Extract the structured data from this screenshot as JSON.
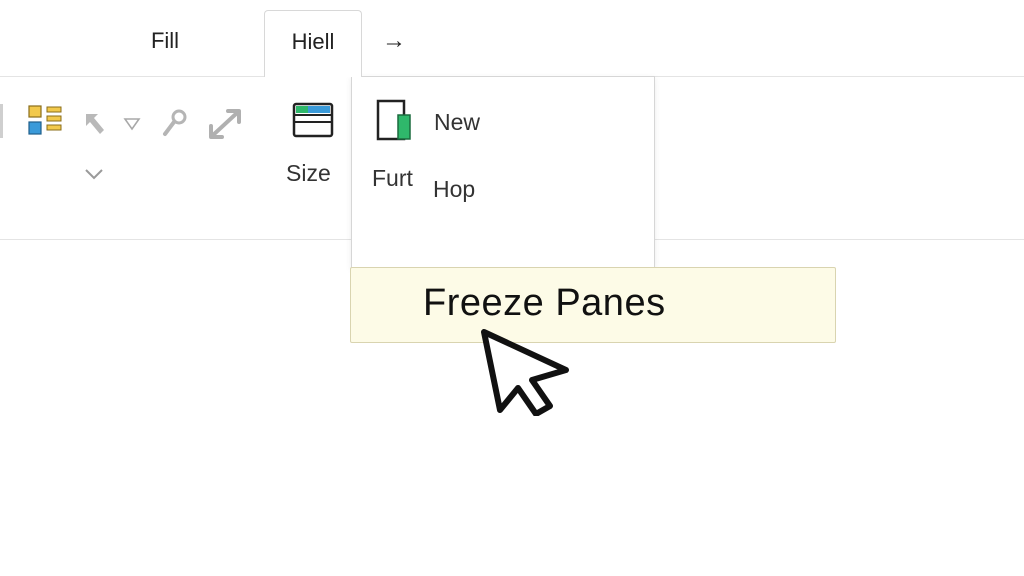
{
  "tabs": {
    "fill_label": "Fill",
    "hiell_label": "Hiell",
    "arrow_glyph": "→"
  },
  "ribbon": {
    "size_label": "Size",
    "icons": [
      "layout-grid-icon",
      "arrow-up-left-icon",
      "dropdown-triangle-icon",
      "pin-icon",
      "resize-icon",
      "chevron-down-icon",
      "window-icon"
    ]
  },
  "dropdown": {
    "furt_label": "Furt",
    "new_label": "New",
    "hop_label": "Hop",
    "icon": "new-document-icon"
  },
  "tooltip": {
    "text": "Freeze Panes",
    "background": "#fdfbe7"
  },
  "colors": {
    "accent_green": "#2fb86b",
    "accent_blue": "#3a9ad9",
    "accent_yellow": "#f2c94c"
  }
}
